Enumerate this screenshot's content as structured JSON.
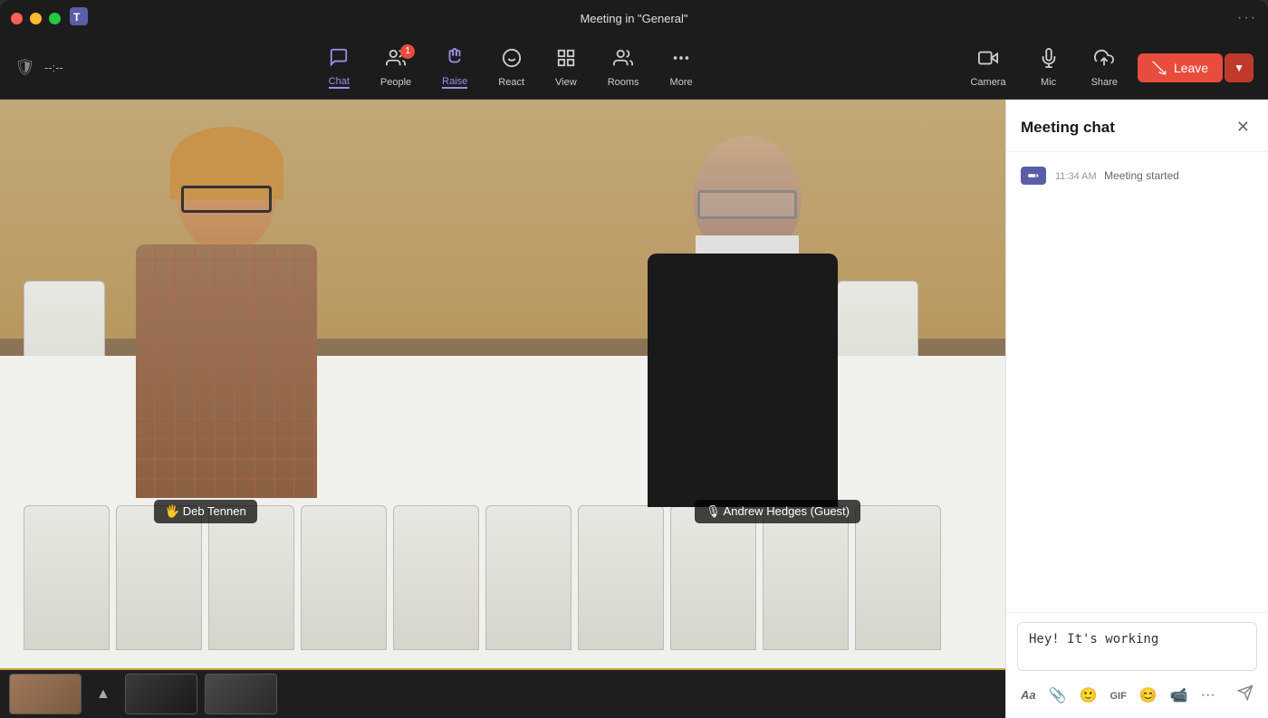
{
  "window": {
    "title": "Meeting in \"General\"",
    "more_label": "···"
  },
  "traffic_lights": {
    "red": "red",
    "yellow": "yellow",
    "green": "green"
  },
  "toolbar_left": {
    "shield_icon": "shield",
    "timer": "--:--"
  },
  "toolbar_center": {
    "buttons": [
      {
        "id": "chat",
        "label": "Chat",
        "icon": "💬",
        "active": true,
        "badge": null
      },
      {
        "id": "people",
        "label": "People",
        "icon": "👥",
        "active": false,
        "badge": "1"
      },
      {
        "id": "raise",
        "label": "Raise",
        "icon": "✋",
        "active": true,
        "badge": null
      },
      {
        "id": "react",
        "label": "React",
        "icon": "🙂",
        "active": false,
        "badge": null
      },
      {
        "id": "view",
        "label": "View",
        "icon": "⊞",
        "active": false,
        "badge": null
      },
      {
        "id": "rooms",
        "label": "Rooms",
        "icon": "👥",
        "active": false,
        "badge": null
      },
      {
        "id": "more",
        "label": "More",
        "icon": "···",
        "active": false,
        "badge": null
      }
    ]
  },
  "toolbar_right": {
    "camera_label": "Camera",
    "mic_label": "Mic",
    "share_label": "Share",
    "leave_label": "Leave"
  },
  "participants": [
    {
      "id": "deb",
      "name": "🖐 Deb Tennen",
      "position": "left"
    },
    {
      "id": "andrew",
      "name": "🎙 Andrew Hedges (Guest)",
      "position": "right"
    }
  ],
  "chat_panel": {
    "title": "Meeting chat",
    "close_label": "✕",
    "messages": [
      {
        "id": "system-start",
        "time": "11:34 AM",
        "text": "Meeting started",
        "type": "system"
      }
    ],
    "input_placeholder": "Hey! It's working",
    "input_value": "Hey! It's working",
    "tools": [
      {
        "id": "format",
        "icon": "Aa"
      },
      {
        "id": "attach",
        "icon": "📎"
      },
      {
        "id": "emoji",
        "icon": "🙂"
      },
      {
        "id": "gif",
        "icon": "GIF"
      },
      {
        "id": "sticker",
        "icon": "😊"
      },
      {
        "id": "video-msg",
        "icon": "📹"
      },
      {
        "id": "more-tools",
        "icon": "···"
      }
    ],
    "send_icon": "➤"
  }
}
